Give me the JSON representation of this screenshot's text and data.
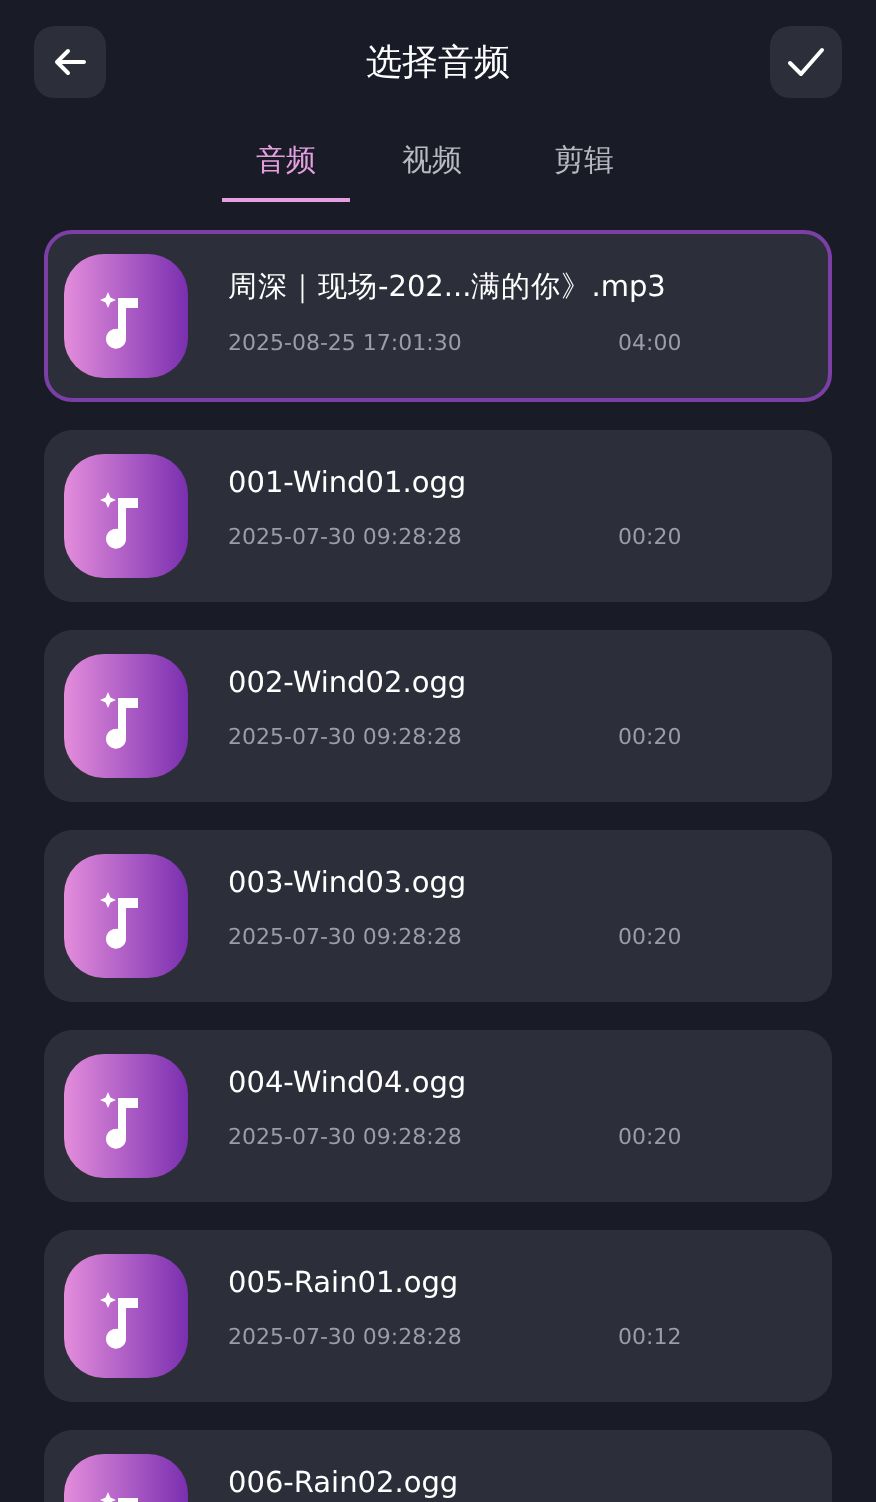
{
  "header": {
    "title": "选择音频"
  },
  "tabs": [
    {
      "label": "音频",
      "selected": true
    },
    {
      "label": "视频",
      "selected": false
    },
    {
      "label": "剪辑",
      "selected": false
    }
  ],
  "files": [
    {
      "name": "周深｜现场-202...满的你》.mp3",
      "date": "2025-08-25 17:01:30",
      "duration": "04:00",
      "selected": true
    },
    {
      "name": "001-Wind01.ogg",
      "date": "2025-07-30 09:28:28",
      "duration": "00:20",
      "selected": false
    },
    {
      "name": "002-Wind02.ogg",
      "date": "2025-07-30 09:28:28",
      "duration": "00:20",
      "selected": false
    },
    {
      "name": "003-Wind03.ogg",
      "date": "2025-07-30 09:28:28",
      "duration": "00:20",
      "selected": false
    },
    {
      "name": "004-Wind04.ogg",
      "date": "2025-07-30 09:28:28",
      "duration": "00:20",
      "selected": false
    },
    {
      "name": "005-Rain01.ogg",
      "date": "2025-07-30 09:28:28",
      "duration": "00:12",
      "selected": false
    },
    {
      "name": "006-Rain02.ogg",
      "selected": false
    }
  ]
}
